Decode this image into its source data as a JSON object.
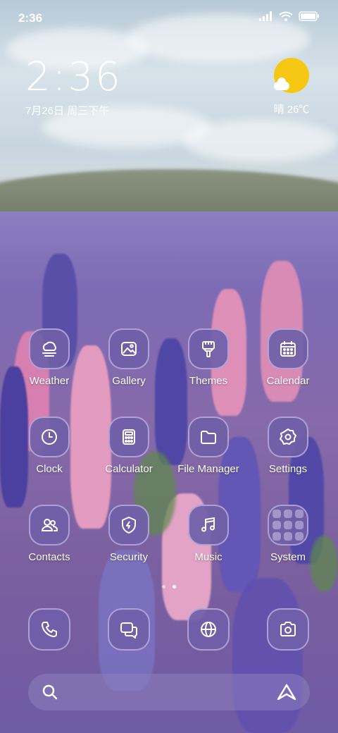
{
  "status_bar": {
    "time": "2:36"
  },
  "clock_widget": {
    "time": "2:36",
    "date": "7月26日 周三下午"
  },
  "weather_widget": {
    "text": "晴 26℃",
    "sun_color": "#f6c713"
  },
  "apps": [
    {
      "label": "Weather",
      "icon": "weather-icon"
    },
    {
      "label": "Gallery",
      "icon": "gallery-icon"
    },
    {
      "label": "Themes",
      "icon": "themes-icon"
    },
    {
      "label": "Calendar",
      "icon": "calendar-icon"
    },
    {
      "label": "Clock",
      "icon": "clock-icon"
    },
    {
      "label": "Calculator",
      "icon": "calculator-icon"
    },
    {
      "label": "File Manager",
      "icon": "folder-icon"
    },
    {
      "label": "Settings",
      "icon": "gear-icon"
    },
    {
      "label": "Contacts",
      "icon": "contacts-icon"
    },
    {
      "label": "Security",
      "icon": "shield-icon"
    },
    {
      "label": "Music",
      "icon": "music-note-icon"
    },
    {
      "label": "System",
      "icon": "system-folder-icon"
    }
  ],
  "dock": [
    {
      "icon": "phone-icon"
    },
    {
      "icon": "messages-icon"
    },
    {
      "icon": "browser-icon"
    },
    {
      "icon": "camera-icon"
    }
  ],
  "pages": {
    "count": 2,
    "current": 2
  },
  "search": {
    "icon": "search-icon",
    "assistant_icon": "assistant-icon"
  },
  "colors": {
    "icon_bg": "#7060a8",
    "text": "#ffffff"
  }
}
